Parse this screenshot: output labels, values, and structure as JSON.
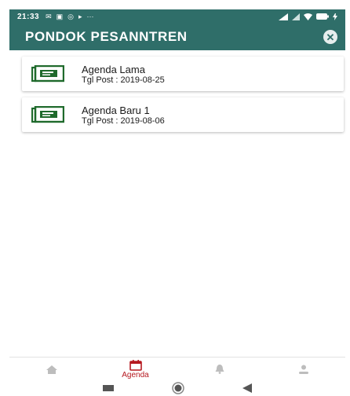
{
  "status_bar": {
    "time": "21:33"
  },
  "app_bar": {
    "title": "PONDOK PESANNTREN"
  },
  "agenda_items": [
    {
      "title": "Agenda Lama",
      "date": "Tgl Post : 2019-08-25"
    },
    {
      "title": "Agenda Baru 1",
      "date": "Tgl Post : 2019-08-06"
    }
  ],
  "bottom_nav": {
    "items": [
      {
        "icon": "home-icon",
        "label": ""
      },
      {
        "icon": "calendar-icon",
        "label": "Agenda"
      },
      {
        "icon": "bell-icon",
        "label": ""
      },
      {
        "icon": "person-icon",
        "label": ""
      }
    ]
  },
  "colors": {
    "primary": "#2f6e69",
    "active": "#b5181f",
    "inactive": "#9e9e9e"
  }
}
